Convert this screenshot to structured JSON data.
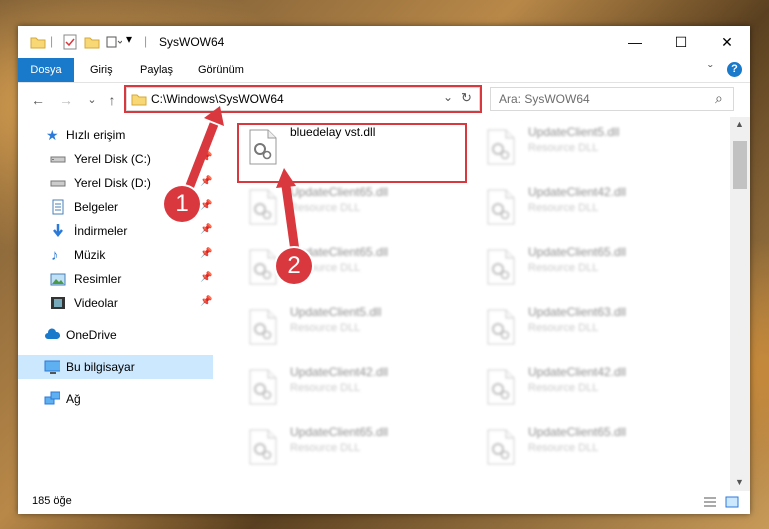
{
  "window": {
    "title": "SysWOW64",
    "minimize_glyph": "—",
    "maximize_glyph": "☐",
    "close_glyph": "✕"
  },
  "ribbon": {
    "tabs": [
      {
        "label": "Dosya"
      },
      {
        "label": "Giriş"
      },
      {
        "label": "Paylaş"
      },
      {
        "label": "Görünüm"
      }
    ],
    "collapse_glyph": "ˇ",
    "help_glyph": "?"
  },
  "navigation": {
    "back": "←",
    "forward": "→",
    "recent": "⌄",
    "up": "↑",
    "address": "C:\\Windows\\SysWOW64",
    "dropdown": "⌄",
    "refresh": "↻",
    "search_placeholder": "Ara: SysWOW64",
    "search_icon": "⌕"
  },
  "sidebar": {
    "items": [
      {
        "label": "Hızlı erişim",
        "icon": "star-icon"
      },
      {
        "label": "Yerel Disk (C:)",
        "icon": "drive-icon",
        "pinned": true
      },
      {
        "label": "Yerel Disk (D:)",
        "icon": "drive-icon",
        "pinned": true
      },
      {
        "label": "Belgeler",
        "icon": "documents-icon",
        "pinned": true
      },
      {
        "label": "İndirmeler",
        "icon": "download-icon",
        "pinned": true
      },
      {
        "label": "Müzik",
        "icon": "music-icon",
        "pinned": true
      },
      {
        "label": "Resimler",
        "icon": "pictures-icon",
        "pinned": true
      },
      {
        "label": "Videolar",
        "icon": "videos-icon",
        "pinned": true
      },
      {
        "label": "OneDrive",
        "icon": "cloud-icon"
      },
      {
        "label": "Bu bilgisayar",
        "icon": "computer-icon",
        "selected": true
      },
      {
        "label": "Ağ",
        "icon": "network-icon"
      }
    ]
  },
  "files": [
    {
      "name": "bluedelay vst.dll",
      "type": ""
    },
    {
      "name": "UpdateClient5.dll",
      "type": "Resource DLL"
    },
    {
      "name": "UpdateClient65.dll",
      "type": "Resource DLL"
    },
    {
      "name": "UpdateClient42.dll",
      "type": "Resource DLL"
    },
    {
      "name": "UpdateClient65.dll",
      "type": "Resource DLL"
    },
    {
      "name": "UpdateClient65.dll",
      "type": "Resource DLL"
    },
    {
      "name": "UpdateClient5.dll",
      "type": "Resource DLL"
    },
    {
      "name": "UpdateClient63.dll",
      "type": "Resource DLL"
    },
    {
      "name": "UpdateClient42.dll",
      "type": "Resource DLL"
    },
    {
      "name": "UpdateClient42.dll",
      "type": "Resource DLL"
    },
    {
      "name": "UpdateClient65.dll",
      "type": "Resource DLL"
    },
    {
      "name": "UpdateClient65.dll",
      "type": "Resource DLL"
    }
  ],
  "status": {
    "count": "185 öğe"
  },
  "annotations": {
    "badge1": "1",
    "badge2": "2",
    "color": "#d9383f"
  }
}
